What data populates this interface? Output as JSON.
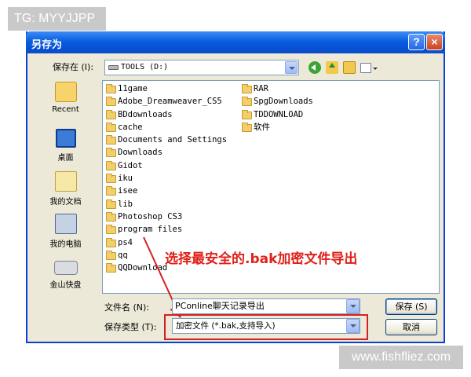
{
  "watermark": {
    "top": "TG: MYYJJPP",
    "bottom": "www.fishfliez.com"
  },
  "dialog": {
    "title": "另存为",
    "help_btn": "?",
    "close_btn": "×",
    "save_in_label": "保存在 (I):",
    "save_in_value": "TOOLS (D:)",
    "places": [
      {
        "label": "Recent",
        "icon": "recent-documents-icon"
      },
      {
        "label": "桌面",
        "icon": "desktop-icon"
      },
      {
        "label": "我的文档",
        "icon": "my-documents-icon"
      },
      {
        "label": "我的电脑",
        "icon": "my-computer-icon"
      },
      {
        "label": "金山快盘",
        "icon": "kingsoft-disk-icon"
      }
    ],
    "files_col1": [
      "11game",
      "Adobe_Dreamweaver_CS5",
      "BDdownloads",
      "cache",
      "Documents and Settings",
      "Downloads",
      "Gidot",
      "iku",
      "isee",
      "lib",
      "Photoshop CS3",
      "program files",
      "ps4",
      "qq",
      "QQDownload"
    ],
    "files_col2": [
      "RAR",
      "SpgDownloads",
      "TDDOWNLOAD",
      "软件"
    ],
    "annotation": "选择最安全的.bak加密文件导出",
    "filename_label": "文件名 (N):",
    "filename_value": "PConline聊天记录导出",
    "filetype_label": "保存类型 (T):",
    "filetype_value": "加密文件 (*.bak,支持导入)",
    "save_btn": "保存 (S)",
    "cancel_btn": "取消"
  },
  "colors": {
    "titlebar": "#0a5ee0",
    "annotation": "#e0201a",
    "dialog_bg": "#ece9d8"
  }
}
